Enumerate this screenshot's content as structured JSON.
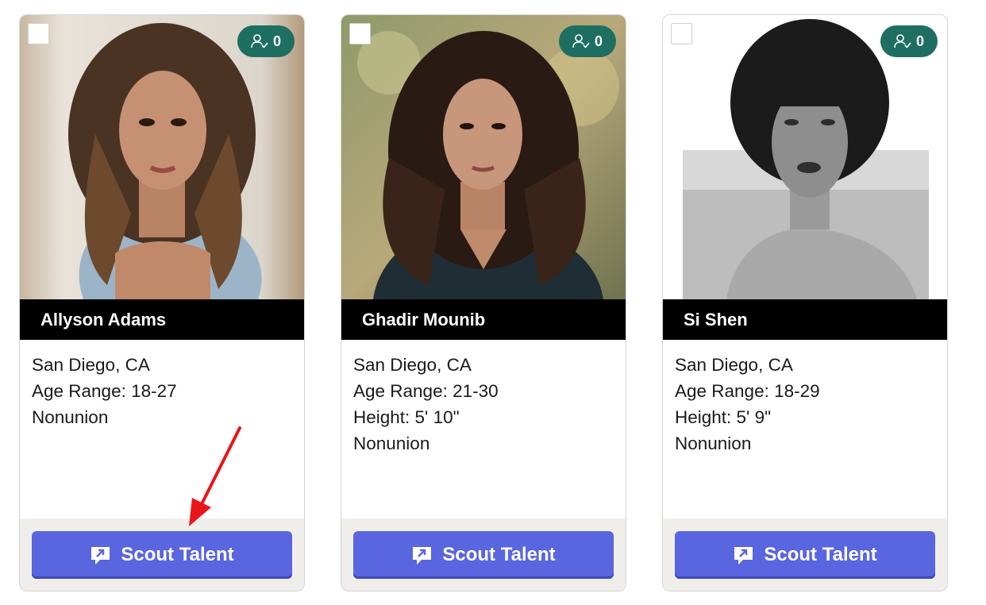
{
  "cards": [
    {
      "name": "Allyson Adams",
      "badge_count": "0",
      "details": [
        "San Diego, CA",
        "Age Range: 18-27",
        "Nonunion"
      ],
      "button_label": "Scout Talent",
      "selected": false
    },
    {
      "name": "Ghadir Mounib",
      "badge_count": "0",
      "details": [
        "San Diego, CA",
        "Age Range: 21-30",
        "Height: 5' 10\"",
        "Nonunion"
      ],
      "button_label": "Scout Talent",
      "selected": false
    },
    {
      "name": "Si Shen",
      "badge_count": "0",
      "details": [
        "San Diego, CA",
        "Age Range: 18-29",
        "Height: 5' 9\"",
        "Nonunion"
      ],
      "button_label": "Scout Talent",
      "selected": false
    }
  ],
  "icons": {
    "badge": "person-check-icon",
    "button": "chat-arrow-icon",
    "annotation": "red-arrow"
  },
  "colors": {
    "badge": "#1e6f61",
    "name_bar": "#000000",
    "button": "#5a65e0",
    "footer": "#efeeea",
    "annotation_arrow": "#e8161b"
  }
}
